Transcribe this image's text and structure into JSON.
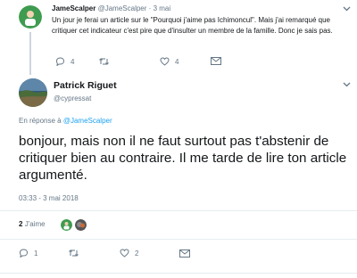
{
  "parent_tweet": {
    "author_name": "JameScalper",
    "author_handle": "@JameScalper",
    "separator": "·",
    "time": "3 mai",
    "text": "Un jour je ferai un article sur le \"Pourquoi j'aime pas Ichimoncul\". Mais j'ai remarqué que critiquer cet indicateur c'est pire que d'insulter un membre de la famille. Donc je sais pas.",
    "reply_count": "4",
    "retweet_count": "",
    "like_count": "4"
  },
  "main_tweet": {
    "author_name": "Patrick Riguet",
    "author_handle": "@cypressat",
    "in_reply_prefix": "En réponse à",
    "in_reply_handle": "@JameScalper",
    "text": "bonjour, mais non il ne faut surtout pas t'abstenir de critiquer bien au contraire. Il me tarde de lire ton article argumenté.",
    "timestamp": "03:33 - 3 mai 2018",
    "likes_count": "2",
    "likes_label": "J'aime",
    "reply_count": "1",
    "retweet_count": "",
    "like_count": "2"
  },
  "colors": {
    "accent": "#1da1f2",
    "muted": "#657786",
    "text": "#14171a",
    "divider": "#e6ecf0"
  },
  "icons": {
    "reply": "reply-icon",
    "retweet": "retweet-icon",
    "like": "heart-icon",
    "dm": "envelope-icon",
    "more": "chevron-down-icon"
  }
}
